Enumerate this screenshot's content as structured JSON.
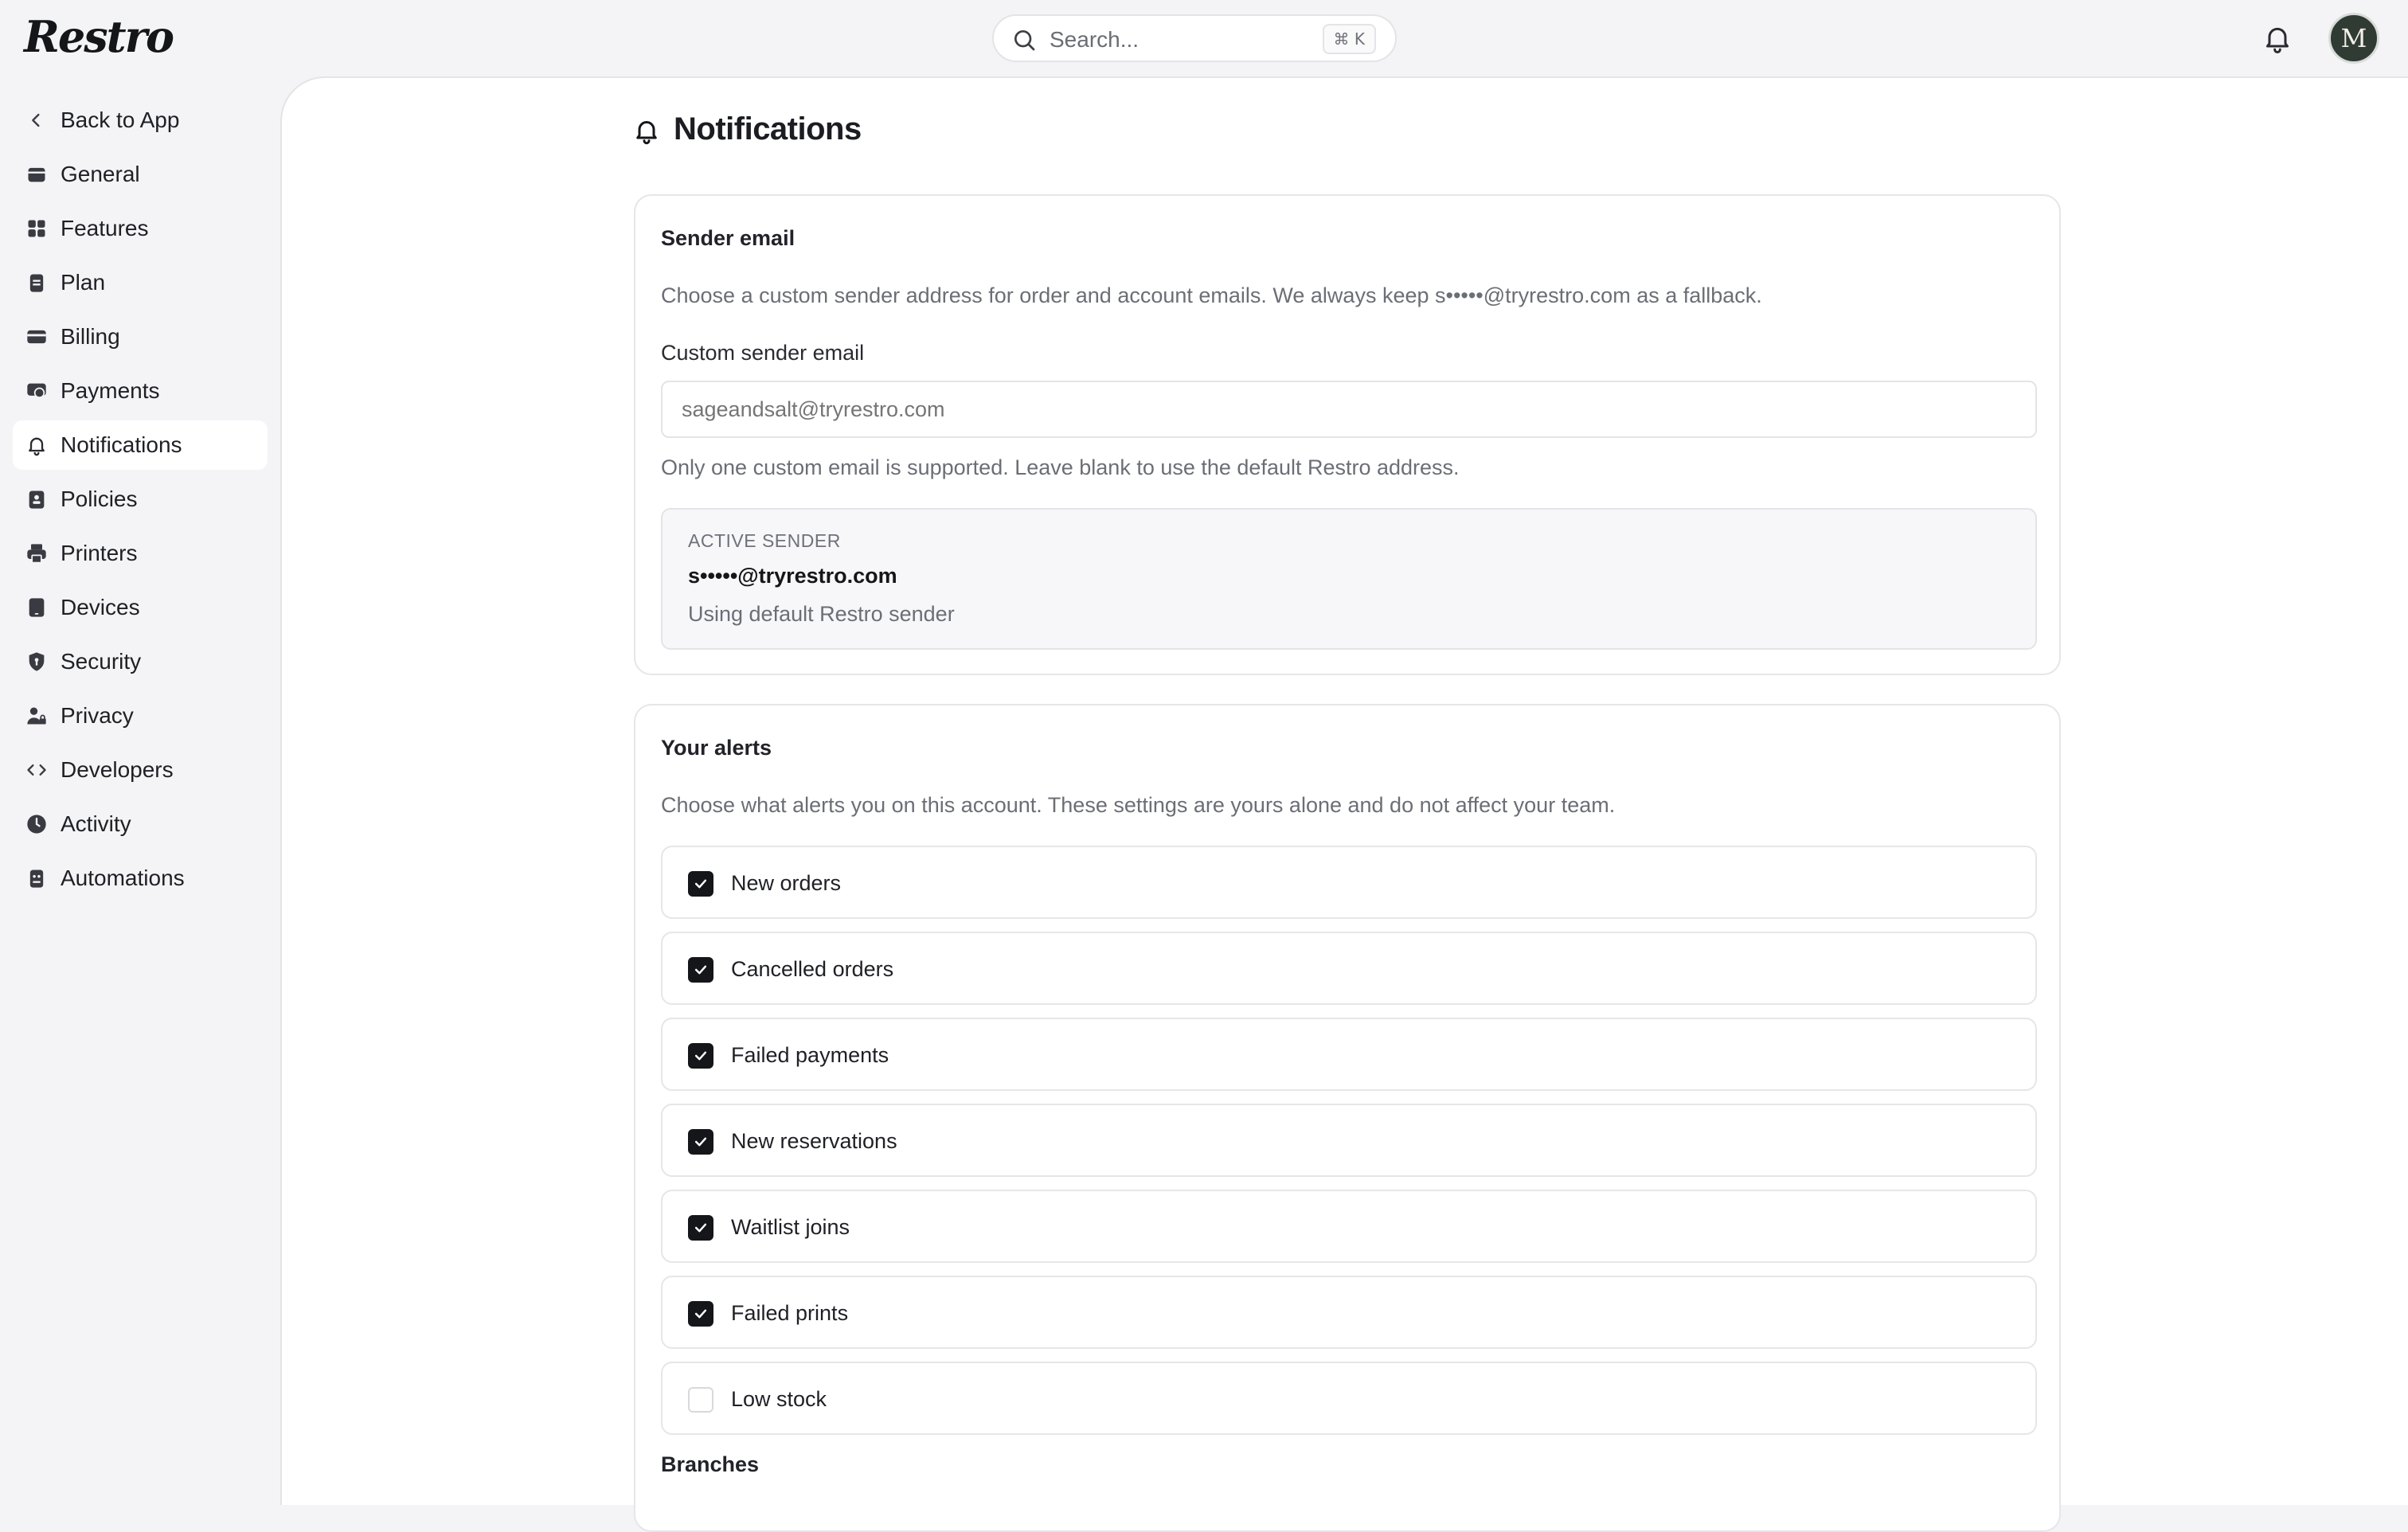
{
  "app": {
    "logo_text": "Restro",
    "avatar_initial": "M"
  },
  "search": {
    "placeholder": "Search...",
    "shortcut": "⌘ K"
  },
  "sidebar": {
    "items": [
      {
        "label": "Back to App",
        "icon": "chevron-left-icon"
      },
      {
        "label": "General",
        "icon": "store-icon"
      },
      {
        "label": "Features",
        "icon": "grid-icon"
      },
      {
        "label": "Plan",
        "icon": "clipboard-icon"
      },
      {
        "label": "Billing",
        "icon": "credit-card-icon"
      },
      {
        "label": "Payments",
        "icon": "payment-icon"
      },
      {
        "label": "Notifications",
        "icon": "bell-icon",
        "active": true
      },
      {
        "label": "Policies",
        "icon": "policy-icon"
      },
      {
        "label": "Printers",
        "icon": "printer-icon"
      },
      {
        "label": "Devices",
        "icon": "tablet-icon"
      },
      {
        "label": "Security",
        "icon": "shield-icon"
      },
      {
        "label": "Privacy",
        "icon": "user-lock-icon"
      },
      {
        "label": "Developers",
        "icon": "code-icon"
      },
      {
        "label": "Activity",
        "icon": "clock-icon"
      },
      {
        "label": "Automations",
        "icon": "robot-icon"
      }
    ]
  },
  "page": {
    "title": "Notifications"
  },
  "sender_email": {
    "title": "Sender email",
    "description": "Choose a custom sender address for order and account emails. We always keep s•••••@tryrestro.com as a fallback.",
    "field_label": "Custom sender email",
    "field_placeholder": "sageandsalt@tryrestro.com",
    "help": "Only one custom email is supported. Leave blank to use the default Restro address.",
    "active": {
      "caption": "ACTIVE SENDER",
      "address": "s•••••@tryrestro.com",
      "note": "Using default Restro sender"
    }
  },
  "alerts": {
    "title": "Your alerts",
    "description": "Choose what alerts you on this account. These settings are yours alone and do not affect your team.",
    "items": [
      {
        "label": "New orders",
        "checked": true
      },
      {
        "label": "Cancelled orders",
        "checked": true
      },
      {
        "label": "Failed payments",
        "checked": true
      },
      {
        "label": "New reservations",
        "checked": true
      },
      {
        "label": "Waitlist joins",
        "checked": true
      },
      {
        "label": "Failed prints",
        "checked": true
      },
      {
        "label": "Low stock",
        "checked": false
      }
    ],
    "branches_title": "Branches"
  }
}
